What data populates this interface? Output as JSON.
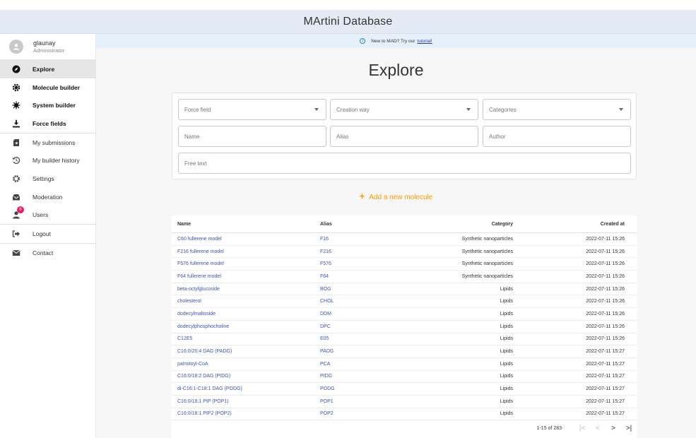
{
  "app": {
    "title": "MArtini Database"
  },
  "user": {
    "name": "glaunay",
    "role": "Administrator"
  },
  "nav": [
    {
      "label": "Explore",
      "icon": "compass-icon",
      "bold": true,
      "active": true
    },
    {
      "label": "Molecule builder",
      "icon": "molecule-gear-icon",
      "bold": true
    },
    {
      "label": "System builder",
      "icon": "virus-icon",
      "bold": true
    },
    {
      "label": "Force fields",
      "icon": "download-icon",
      "bold": true
    },
    {
      "label": "My submissions",
      "icon": "submissions-icon"
    },
    {
      "label": "My builder history",
      "icon": "history-icon"
    },
    {
      "label": "Settings",
      "icon": "gear-icon"
    },
    {
      "label": "Moderation",
      "icon": "inbox-icon"
    },
    {
      "label": "Users",
      "icon": "user-icon",
      "badge": "6"
    },
    {
      "label": "Logout",
      "icon": "logout-icon"
    },
    {
      "label": "Contact",
      "icon": "mail-icon"
    }
  ],
  "notice": {
    "text": "New to MAD? Try our",
    "link": "tutorial!"
  },
  "page": {
    "title": "Explore"
  },
  "filters": {
    "force_field": "Force field",
    "creation_way": "Creation way",
    "categories": "Categories",
    "name": "Name",
    "alias": "Alias",
    "author": "Author",
    "free_text": "Free text"
  },
  "add_button": {
    "label": "Add a new molecule"
  },
  "table": {
    "columns": [
      "Name",
      "Alias",
      "Category",
      "Created at"
    ],
    "rows": [
      [
        "C60 fullerene model",
        "F16",
        "Synthetic nanoparticles",
        "2022-07-11 15:26"
      ],
      [
        "F216 fullerene model",
        "F216",
        "Synthetic nanoparticles",
        "2022-07-11 15:26"
      ],
      [
        "F576 fullerene model",
        "F576",
        "Synthetic nanoparticles",
        "2022-07-11 15:26"
      ],
      [
        "F64 fullerene model",
        "F64",
        "Synthetic nanoparticles",
        "2022-07-11 15:26"
      ],
      [
        "beta-octylglucoside",
        "BOG",
        "Lipids",
        "2022-07-11 15:26"
      ],
      [
        "cholesterol",
        "CHOL",
        "Lipids",
        "2022-07-11 15:26"
      ],
      [
        "dodecylmaltoside",
        "DDM",
        "Lipids",
        "2022-07-11 15:26"
      ],
      [
        "dodecylphosphocholine",
        "DPC",
        "Lipids",
        "2022-07-11 15:26"
      ],
      [
        "C12E5",
        "E05",
        "Lipids",
        "2022-07-11 15:26"
      ],
      [
        "C16:0/20:4 DAG (PADG)",
        "PADG",
        "Lipids",
        "2022-07-11 15:27"
      ],
      [
        "palmitoyl-CoA",
        "PCA",
        "Lipids",
        "2022-07-11 15:27"
      ],
      [
        "C16:0/18:2 DAG (PIDG)",
        "PIDG",
        "Lipids",
        "2022-07-11 15:27"
      ],
      [
        "di-C16:1-C18:1 DAG (PODG)",
        "PODG",
        "Lipids",
        "2022-07-11 15:27"
      ],
      [
        "C16:0/18:1 PIP (POP1)",
        "POP1",
        "Lipids",
        "2022-07-11 15:27"
      ],
      [
        "C16:0/18:1 PIP2 (POP2)",
        "POP2",
        "Lipids",
        "2022-07-11 15:27"
      ]
    ]
  },
  "pagination": {
    "range": "1-15 of 283",
    "first": "|<",
    "prev": "<",
    "next": ">",
    "last": ">|"
  },
  "colors": {
    "accent": "#ff9800",
    "link": "#3a55b4",
    "topbar": "#e3eaf4",
    "badge": "#e91e63"
  }
}
